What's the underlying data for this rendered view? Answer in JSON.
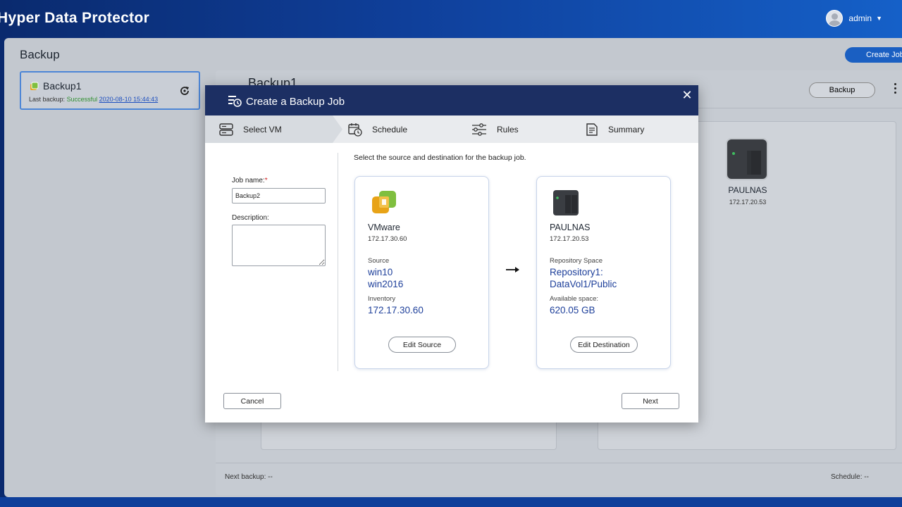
{
  "app": {
    "title": "Hyper Data Protector"
  },
  "user": {
    "name": "admin"
  },
  "page": {
    "title": "Backup",
    "create_job_label": "Create Job"
  },
  "job_list": [
    {
      "name": "Backup1",
      "last_backup_label": "Last backup:",
      "status": "Successful",
      "timestamp": "2020-08-10 15:44:43"
    }
  ],
  "detail": {
    "title": "Backup1",
    "backup_label": "Backup",
    "destination": {
      "name": "PAULNAS",
      "ip": "172.17.20.53"
    },
    "next_backup": "Next backup: --",
    "schedule": "Schedule: --"
  },
  "modal": {
    "title": "Create a Backup Job",
    "steps": [
      "Select VM",
      "Schedule",
      "Rules",
      "Summary"
    ],
    "active_step": 0,
    "job_name_label": "Job name:",
    "job_name_required": "*",
    "job_name_value": "Backup2",
    "description_label": "Description:",
    "description_value": "",
    "instruction": "Select the source and destination for the backup job.",
    "source": {
      "name": "VMware",
      "ip": "172.17.30.60",
      "source_label": "Source",
      "source_values": [
        "win10",
        "win2016"
      ],
      "inventory_label": "Inventory",
      "inventory_value": "172.17.30.60",
      "edit_label": "Edit Source"
    },
    "destination": {
      "name": "PAULNAS",
      "ip": "172.17.20.53",
      "repo_label": "Repository Space",
      "repo_values": [
        "Repository1:",
        "DataVol1/Public"
      ],
      "available_label": "Available space:",
      "available_value": "620.05 GB",
      "edit_label": "Edit Destination"
    },
    "cancel_label": "Cancel",
    "next_label": "Next"
  },
  "colors": {
    "header_navy": "#1c2f63",
    "accent_blue": "#1a5fc2",
    "value_blue": "#1d3f9a",
    "success_green": "#2f8f2f",
    "required_red": "#d32020"
  }
}
